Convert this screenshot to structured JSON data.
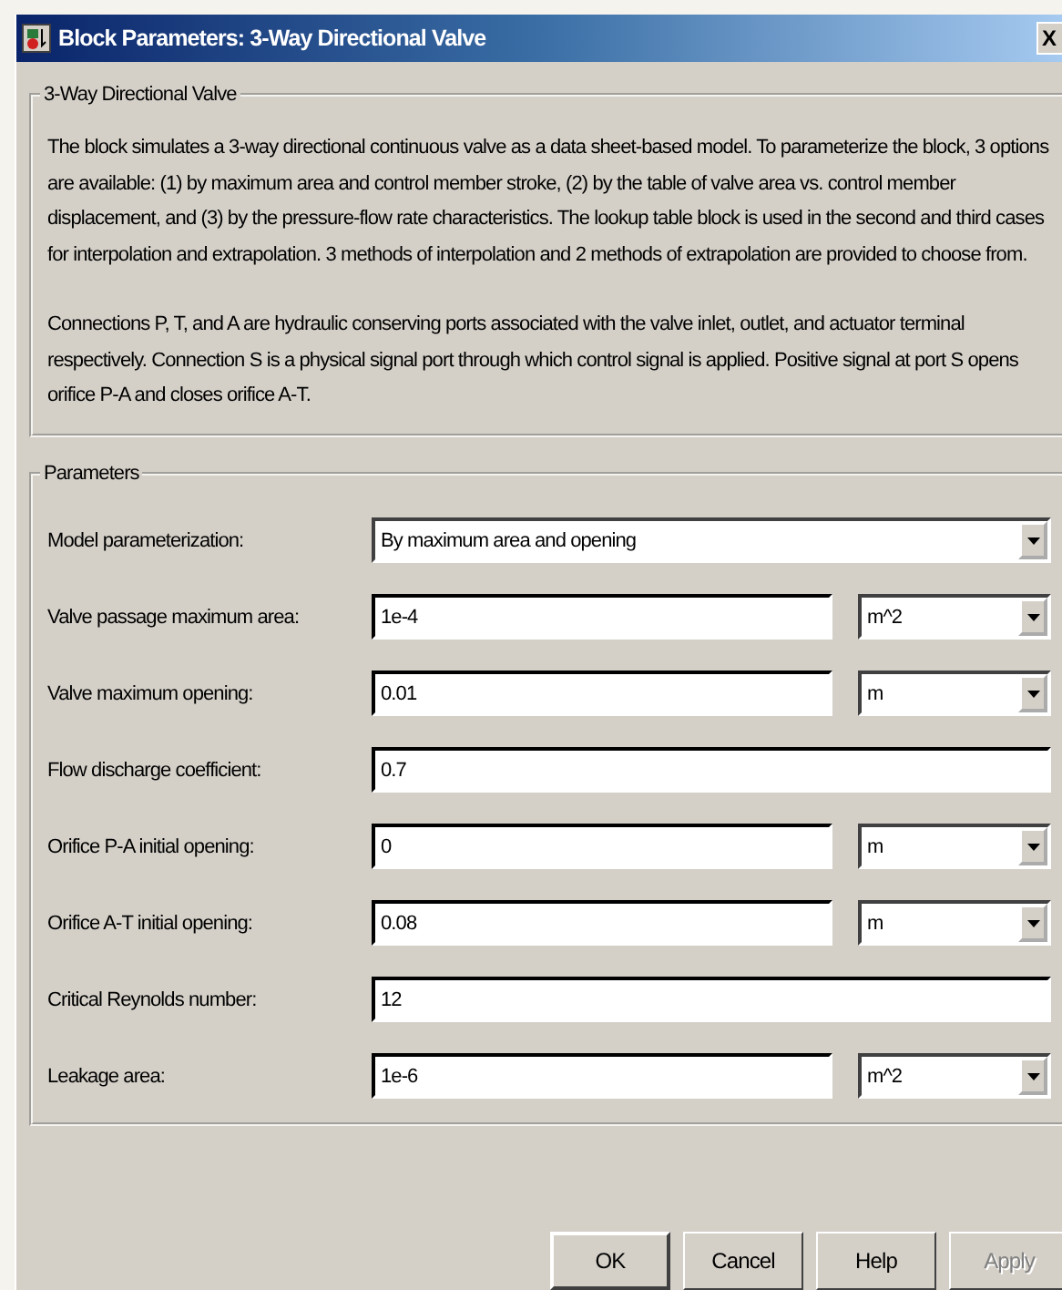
{
  "window": {
    "title": "Block Parameters: 3-Way Directional Valve",
    "close": "X"
  },
  "description": {
    "title": "3-Way Directional Valve",
    "paragraphs": [
      "The block simulates a 3-way directional continuous valve as a data sheet-based model. To parameterize the block, 3 options are available: (1) by maximum area and control member stroke, (2) by the table of valve area vs. control member displacement, and (3) by the pressure-flow rate characteristics. The lookup table block is used in the second and third cases for interpolation and extrapolation. 3 methods of interpolation and 2 methods of extrapolation are provided to choose from.",
      "Connections P, T, and A are hydraulic conserving ports associated with the valve inlet, outlet, and actuator terminal respectively. Connection S is a physical signal port through which control signal is applied. Positive signal at port S opens orifice P-A and closes orifice A-T."
    ]
  },
  "parameters": {
    "title": "Parameters",
    "rows": [
      {
        "kind": "select",
        "label": "Model parameterization:",
        "value": "By maximum area and opening"
      },
      {
        "kind": "field",
        "label": "Valve passage maximum area:",
        "value": "1e-4",
        "unit": "m^2"
      },
      {
        "kind": "field",
        "label": "Valve maximum opening:",
        "value": "0.01",
        "unit": "m"
      },
      {
        "kind": "field",
        "label": "Flow discharge coefficient:",
        "value": "0.7"
      },
      {
        "kind": "field",
        "label": "Orifice P-A initial opening:",
        "value": "0",
        "unit": "m"
      },
      {
        "kind": "field",
        "label": "Orifice A-T initial opening:",
        "value": "0.08",
        "unit": "m"
      },
      {
        "kind": "field",
        "label": "Critical Reynolds number:",
        "value": "12"
      },
      {
        "kind": "field",
        "label": "Leakage area:",
        "value": "1e-6",
        "unit": "m^2"
      }
    ]
  },
  "buttons": [
    {
      "label": "OK",
      "disabled": false,
      "default": true
    },
    {
      "label": "Cancel",
      "disabled": false,
      "default": false
    },
    {
      "label": "Help",
      "disabled": false,
      "default": false
    },
    {
      "label": "Apply",
      "disabled": true,
      "default": false
    }
  ]
}
